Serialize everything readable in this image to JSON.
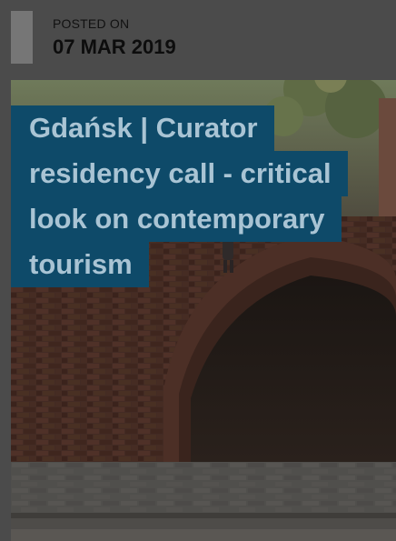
{
  "post": {
    "posted_label": "POSTED ON",
    "posted_date": "07 MAR 2019",
    "title_lines": [
      "Gdańsk | Curator",
      "residency call - critical",
      "look on contemporary",
      "tourism"
    ]
  },
  "colors": {
    "title_background": "#0e4a69",
    "title_text": "#a9c4d4",
    "page_background": "#4b4b4b",
    "accent_bar": "#767676"
  },
  "image": {
    "subject": "brick-arch-photo"
  }
}
